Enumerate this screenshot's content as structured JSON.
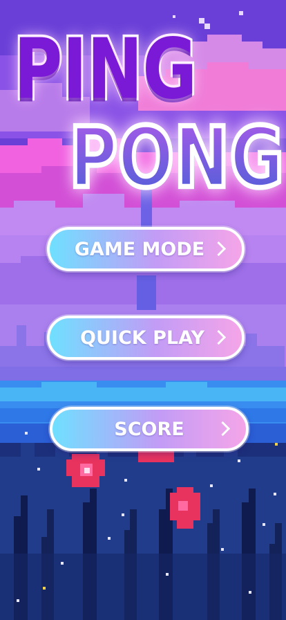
{
  "title": {
    "line1": "PING",
    "line2": "PONG"
  },
  "menu": {
    "game_mode": "GAME MODE",
    "quick_play": "QUICK PLAY",
    "score": "SCORE"
  },
  "colors": {
    "sky_top": "#6a3fd8",
    "cloud_pink": "#f06be6",
    "cloud_lavender": "#b58cf0",
    "water_blue": "#2d8cf0",
    "grass_navy": "#1c2f7a",
    "flower_red": "#e8335f",
    "button_left": "#6fe0ff",
    "button_right": "#f5a5e8",
    "title_purple": "#7a19d6"
  }
}
